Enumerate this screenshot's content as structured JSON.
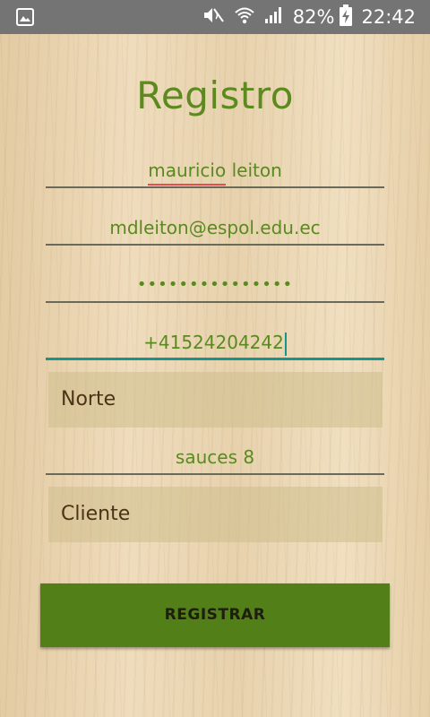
{
  "status_bar": {
    "battery_text": "82%",
    "time": "22:42",
    "icons": [
      "image-notification-icon",
      "mute-icon",
      "wifi-icon",
      "signal-icon",
      "battery-charging-icon"
    ]
  },
  "form": {
    "title": "Registro",
    "name_first": "mauricio",
    "name_rest": " leiton",
    "email": "mdleiton@espol.edu.ec",
    "password_mask": "•••••••••••••••",
    "phone": "+41524204242",
    "zone": "Norte",
    "address": "sauces 8",
    "role": "Cliente",
    "submit_label": "REGISTRAR"
  },
  "colors": {
    "accent_green": "#5a8a1f",
    "button_green": "#527f17",
    "focus_teal": "#17948c",
    "status_bar": "#747474"
  }
}
